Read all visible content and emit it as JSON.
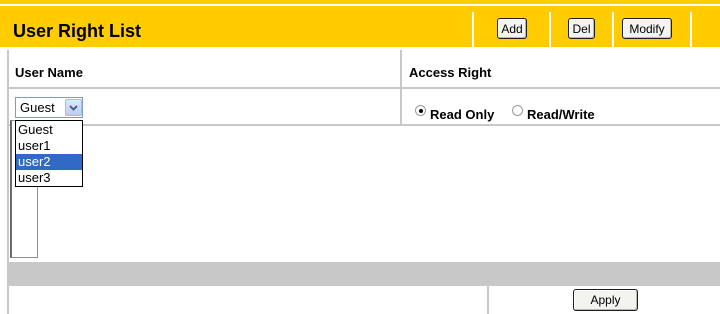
{
  "header": {
    "title": "User Right List",
    "add_label": "Add",
    "del_label": "Del",
    "modify_label": "Modify"
  },
  "columns": {
    "user_name": "User Name",
    "access_right": "Access Right"
  },
  "user_select": {
    "selected": "Guest",
    "options": [
      "Guest",
      "user1",
      "user2",
      "user3"
    ],
    "highlighted": "user2"
  },
  "access": {
    "read_only_label": "Read Only",
    "read_write_label": "Read/Write",
    "selected": "Read Only"
  },
  "footer": {
    "apply_label": "Apply"
  },
  "colors": {
    "header_bg": "#ffcc00",
    "grid": "#c8c8c8",
    "highlight": "#316ac5"
  }
}
